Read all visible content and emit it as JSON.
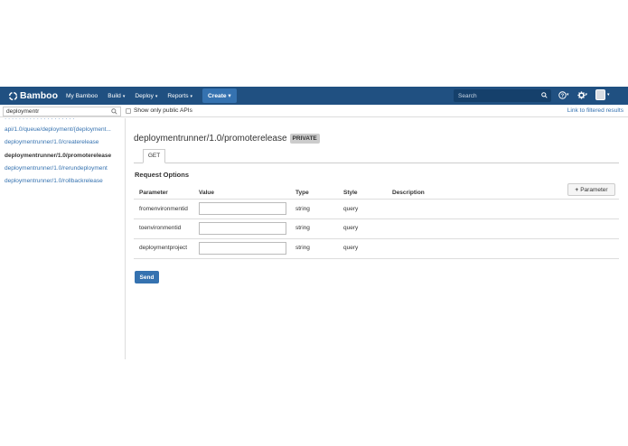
{
  "header": {
    "logo_text": "Bamboo",
    "nav": [
      {
        "label": "My Bamboo",
        "caret": ""
      },
      {
        "label": "Build",
        "caret": "▾"
      },
      {
        "label": "Deploy",
        "caret": "▾"
      },
      {
        "label": "Reports",
        "caret": "▾"
      }
    ],
    "create_label": "Create",
    "create_caret": "▾",
    "search_placeholder": "Search",
    "help_icon": "help-icon",
    "settings_icon": "gear-icon",
    "brand_color": "#205081"
  },
  "toolbar": {
    "filter_value": "deploymentr",
    "public_only_label": "Show only public APIs",
    "public_only_checked": false,
    "filtered_link": "Link to filtered results"
  },
  "sidebar": {
    "items": [
      {
        "label": "api/1.0/queue/deployment/{deployment...",
        "active": false
      },
      {
        "label": "deploymentrunner/1.0/createrelease",
        "active": false
      },
      {
        "label": "deploymentrunner/1.0/promoterelease",
        "active": true
      },
      {
        "label": "deploymentrunner/1.0/rerundeployment",
        "active": false
      },
      {
        "label": "deploymentrunner/1.0/rollbackrelease",
        "active": false
      }
    ]
  },
  "main": {
    "title": "deploymentrunner/1.0/promoterelease",
    "badge": "PRIVATE",
    "tab": "GET",
    "section_title": "Request Options",
    "columns": [
      "Parameter",
      "Value",
      "Type",
      "Style",
      "Description"
    ],
    "add_parameter_label": "Parameter",
    "rows": [
      {
        "parameter": "fromenvironmentid",
        "value": "",
        "type": "string",
        "style": "query",
        "description": ""
      },
      {
        "parameter": "toenvironmentid",
        "value": "",
        "type": "string",
        "style": "query",
        "description": ""
      },
      {
        "parameter": "deploymentproject",
        "value": "",
        "type": "string",
        "style": "query",
        "description": ""
      }
    ],
    "send_label": "Send",
    "accent_color": "#3572b0"
  }
}
